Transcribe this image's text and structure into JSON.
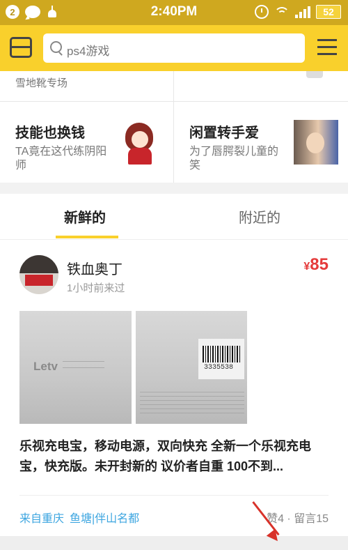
{
  "status_bar": {
    "notification_count": "2",
    "time": "2:40PM",
    "battery": "52"
  },
  "header": {
    "search_placeholder": "ps4游戏"
  },
  "categories": {
    "cut_left_subtitle": "雪地靴专场",
    "items": [
      {
        "title": "技能也换钱",
        "subtitle": "TA竟在这代练阴阳师"
      },
      {
        "title": "闲置转手爱",
        "subtitle": "为了唇腭裂儿童的笑"
      }
    ]
  },
  "tabs": [
    {
      "label": "新鲜的",
      "active": true
    },
    {
      "label": "附近的",
      "active": false
    }
  ],
  "post": {
    "user_name": "铁血奥丁",
    "last_seen": "1小时前来过",
    "price_currency": "¥",
    "price": "85",
    "photo_brand": "Letv",
    "barcode_number": "3335538",
    "description": "乐视充电宝，移动电源，双向快充 全新一个乐视充电宝，快充版。未开封新的 议价者自重 100不到...",
    "location_from": "来自重庆",
    "location_pond": "鱼塘|伴山名都",
    "likes": "赞4",
    "comments": "留言15"
  },
  "colors": {
    "brand_yellow": "#f9d02c",
    "price_red": "#e53b3b",
    "link_blue": "#3ea6e0"
  }
}
